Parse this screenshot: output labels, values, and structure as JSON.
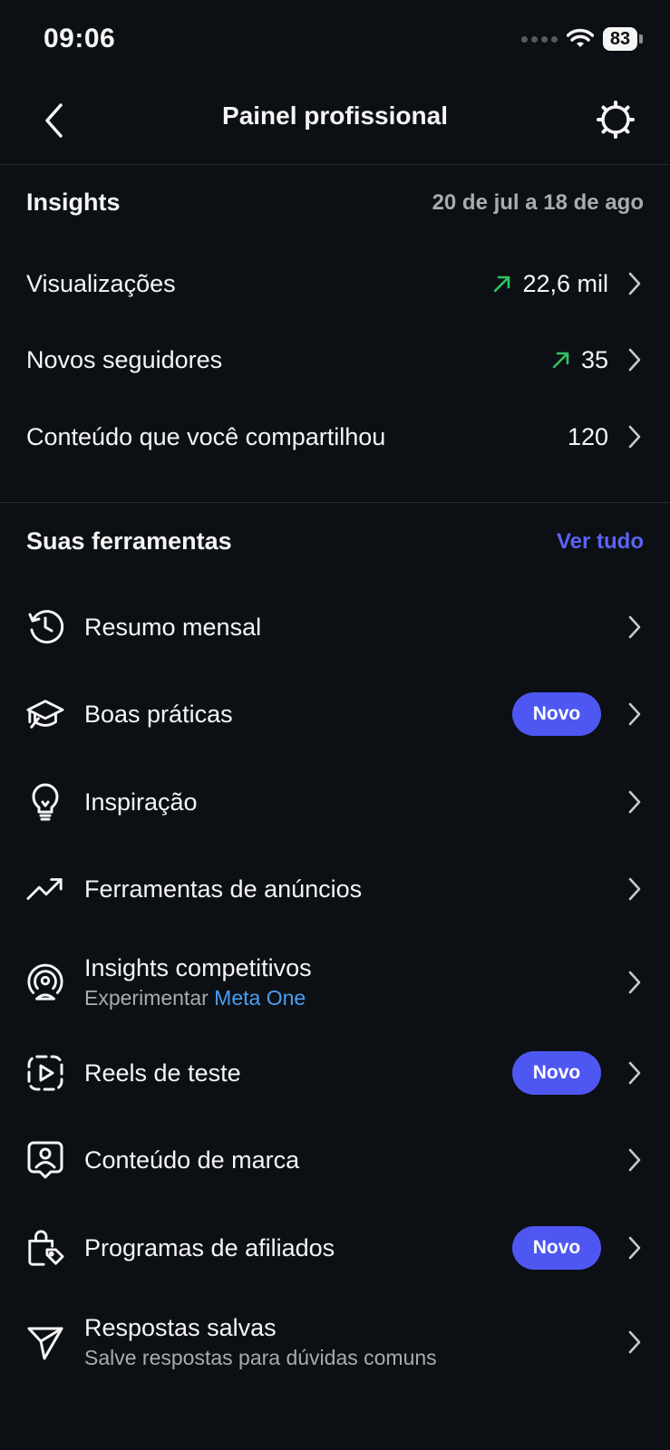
{
  "status_bar": {
    "time": "09:06",
    "battery": "83"
  },
  "nav": {
    "title": "Painel profissional"
  },
  "insights": {
    "title": "Insights",
    "date_range": "20 de jul a 18 de ago",
    "rows": [
      {
        "label": "Visualizações",
        "value": "22,6 mil",
        "trend": "up"
      },
      {
        "label": "Novos seguidores",
        "value": "35",
        "trend": "up"
      },
      {
        "label": "Conteúdo que você compartilhou",
        "value": "120",
        "trend": "none"
      }
    ]
  },
  "tools": {
    "title": "Suas ferramentas",
    "see_all": "Ver tudo",
    "badge_label": "Novo",
    "items": [
      {
        "label": "Resumo mensal",
        "icon": "history-icon"
      },
      {
        "label": "Boas práticas",
        "icon": "graduation-cap-icon",
        "badge": "Novo"
      },
      {
        "label": "Inspiração",
        "icon": "lightbulb-icon"
      },
      {
        "label": "Ferramentas de anúncios",
        "icon": "trending-up-icon"
      },
      {
        "label": "Insights competitivos",
        "icon": "broadcast-person-icon",
        "sub": "Experimentar ",
        "sub_link": "Meta One"
      },
      {
        "label": "Reels de teste",
        "icon": "reels-test-icon",
        "badge": "Novo"
      },
      {
        "label": "Conteúdo de marca",
        "icon": "branded-content-icon"
      },
      {
        "label": "Programas de afiliados",
        "icon": "shopping-bag-tag-icon",
        "badge": "Novo"
      },
      {
        "label": "Respostas salvas",
        "icon": "paper-plane-icon",
        "sub": "Salve respostas para dúvidas comuns"
      }
    ]
  },
  "colors": {
    "background": "#0c1014",
    "accent": "#4e57f2",
    "link": "#4a9ef5",
    "trend_up": "#2fc464",
    "muted": "#a8acb1"
  }
}
